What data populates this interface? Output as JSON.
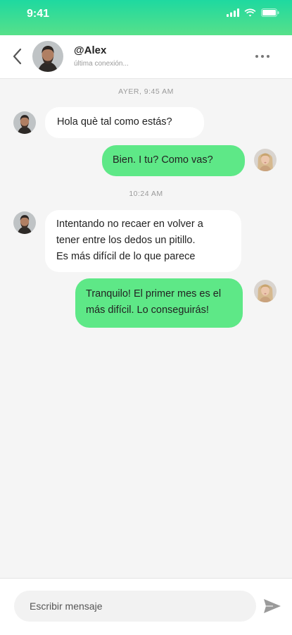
{
  "status_bar": {
    "time": "9:41"
  },
  "header": {
    "contact_name": "@Alex",
    "contact_status": "última conexión...",
    "back_icon": "chevron-left-icon",
    "more_icon": "more-horizontal-icon"
  },
  "messages": [
    {
      "type": "timestamp",
      "text": "AYER, 9:45 AM"
    },
    {
      "type": "incoming",
      "text": "Hola què tal como estás?"
    },
    {
      "type": "outgoing",
      "text": "Bien. I tu? Como vas?"
    },
    {
      "type": "timestamp",
      "text": "10:24 AM"
    },
    {
      "type": "incoming",
      "lines": [
        "Intentando no recaer en volver a",
        "tener entre los dedos un pitillo.",
        "Es más difícil de lo que parece"
      ]
    },
    {
      "type": "outgoing",
      "lines": [
        "Tranquilo! El primer mes es el",
        "más difícil. Lo conseguirás!"
      ]
    }
  ],
  "composer": {
    "placeholder": "Escribir mensaje",
    "send_icon": "send-icon"
  },
  "colors": {
    "accent": "#1ed9a0",
    "outgoing_bubble": "#5ee887",
    "background": "#f5f5f5"
  }
}
